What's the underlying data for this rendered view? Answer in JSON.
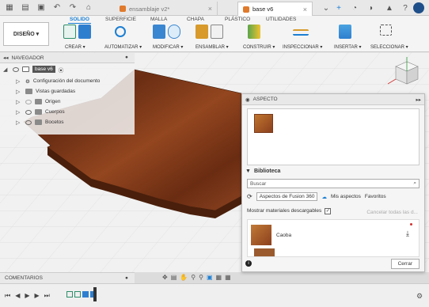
{
  "titlebar": {
    "tabs": [
      {
        "label": "ensamblaje v2*",
        "active": false
      },
      {
        "label": "base v6",
        "active": true
      }
    ]
  },
  "ribbon": {
    "tabs": [
      "SOLIDO",
      "SUPERFICIE",
      "MALLA",
      "CHAPA",
      "PLÁSTICO",
      "UTILIDADES"
    ],
    "active_tab": "SOLIDO",
    "workspace": "DISEÑO ▾",
    "groups": [
      "CREAR ▾",
      "AUTOMATIZAR ▾",
      "MODIFICAR ▾",
      "ENSAMBLAR ▾",
      "CONSTRUIR ▾",
      "INSPECCIONAR ▾",
      "INSERTAR ▾",
      "SELECCIONAR ▾"
    ]
  },
  "navigator": {
    "title": "NAVEGADOR",
    "root": "base v6",
    "items": [
      "Configuración del documento",
      "Vistas guardadas",
      "Origen",
      "Cuerpos",
      "Bocetos"
    ]
  },
  "panel": {
    "title": "ASPECTO",
    "library_title": "Biblioteca",
    "search_placeholder": "Buscar",
    "tabs": [
      "Aspectos de Fusion 360",
      "Mis aspectos",
      "Favoritos"
    ],
    "show_downloadable": "Mostrar materiales descargables",
    "cancel_all": "Cancelar todas las d...",
    "material": "Caoba",
    "close": "Cerrar"
  },
  "comments": "COMENTARIOS",
  "colors": {
    "accent": "#1b7fd3",
    "wood": "#7a3a1c"
  }
}
